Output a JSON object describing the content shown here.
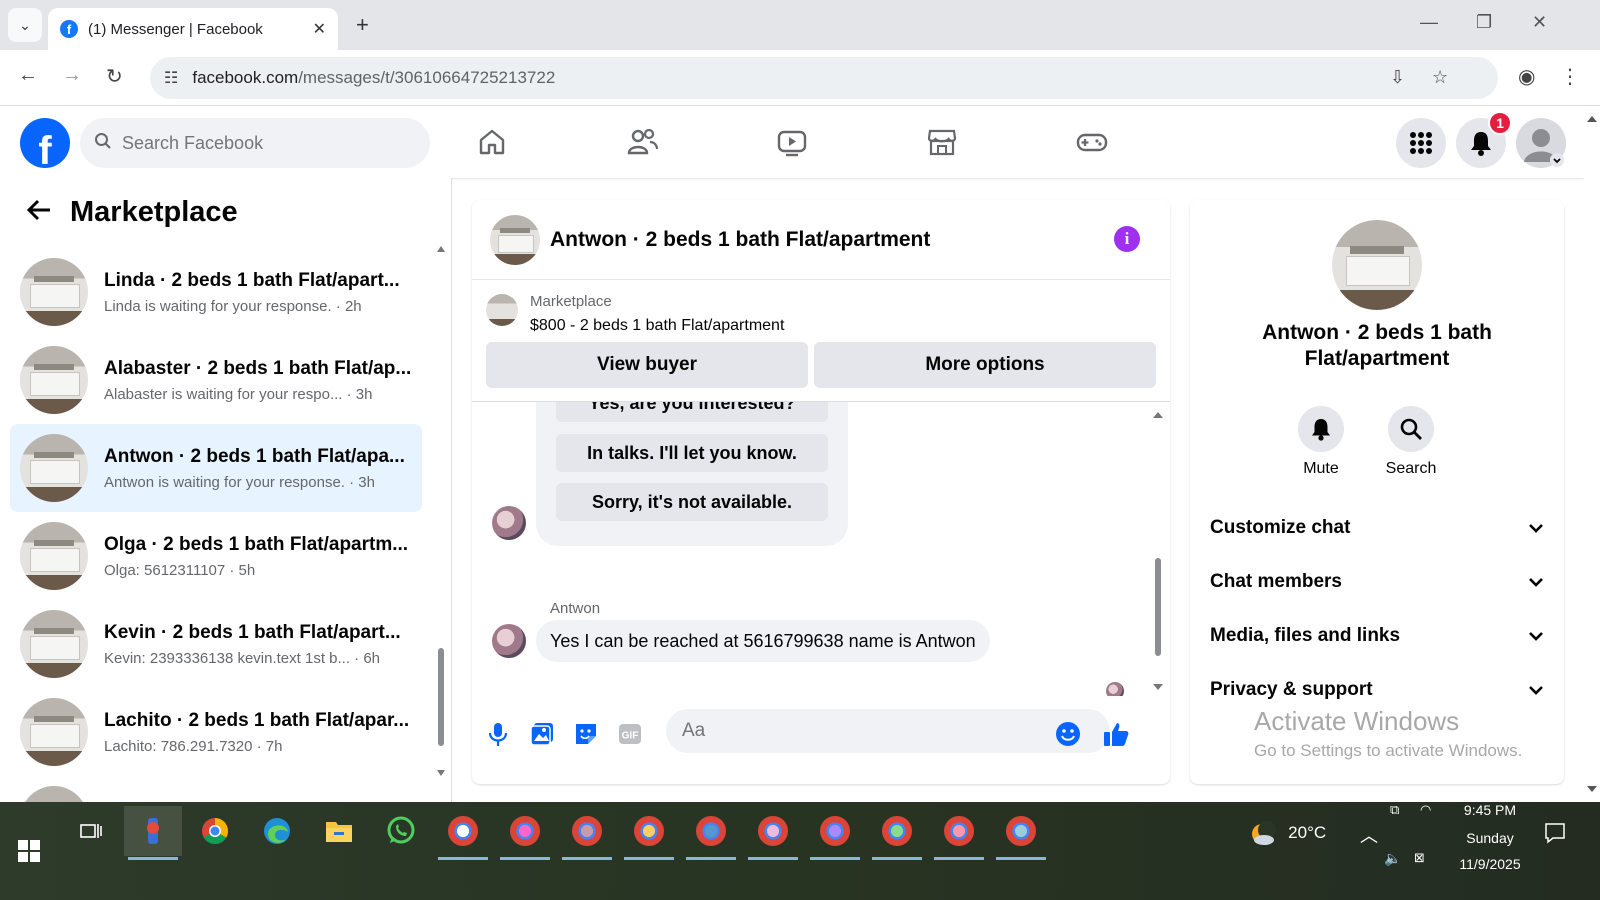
{
  "browser": {
    "tab_title": "(1) Messenger | Facebook",
    "url_host": "facebook.com",
    "url_path": "/messages/t/30610664725213722"
  },
  "fb": {
    "search_placeholder": "Search Facebook",
    "notification_count": "1"
  },
  "sidebar": {
    "title": "Marketplace",
    "conversations": [
      {
        "name": "Linda · 2 beds 1 bath Flat/apart...",
        "preview": "Linda is waiting for your response. · 2h"
      },
      {
        "name": "Alabaster · 2 beds 1 bath Flat/ap...",
        "preview": "Alabaster is waiting for your respo... · 3h"
      },
      {
        "name": "Antwon · 2 beds 1 bath Flat/apa...",
        "preview": "Antwon is waiting for your response. · 3h"
      },
      {
        "name": "Olga · 2 beds 1 bath Flat/apartm...",
        "preview": "Olga: 5612311107 · 5h"
      },
      {
        "name": "Kevin · 2 beds 1 bath Flat/apart...",
        "preview": "Kevin: 2393336138 kevin.text 1st b... · 6h"
      },
      {
        "name": "Lachito · 2 beds 1 bath Flat/apar...",
        "preview": "Lachito: 786.291.7320 · 7h"
      }
    ]
  },
  "chat": {
    "title": "Antwon · 2 beds 1 bath Flat/apartment",
    "marketplace_label": "Marketplace",
    "listing": "$800 - 2 beds 1 bath Flat/apartment",
    "view_buyer": "View buyer",
    "more_options": "More options",
    "quick_replies": [
      "Yes, are you interested?",
      "In talks. I'll let you know.",
      "Sorry, it's not available."
    ],
    "sender": "Antwon",
    "message": "Yes I can be reached at 5616799638 name is Antwon",
    "input_placeholder": "Aa"
  },
  "info": {
    "name": "Antwon · 2 beds 1 bath Flat/apartment",
    "mute": "Mute",
    "search": "Search",
    "rows": [
      "Customize chat",
      "Chat members",
      "Media, files and links",
      "Privacy & support"
    ]
  },
  "watermark": {
    "line1": "Activate Windows",
    "line2": "Go to Settings to activate Windows."
  },
  "taskbar": {
    "weather": "20°C",
    "time": "9:45 PM",
    "day": "Sunday",
    "date": "11/9/2025"
  },
  "colors": {
    "fb_blue": "#0866ff",
    "active_conversation": "#e7f3ff",
    "info_purple": "#a030f0",
    "badge_red": "#e41e3f"
  }
}
